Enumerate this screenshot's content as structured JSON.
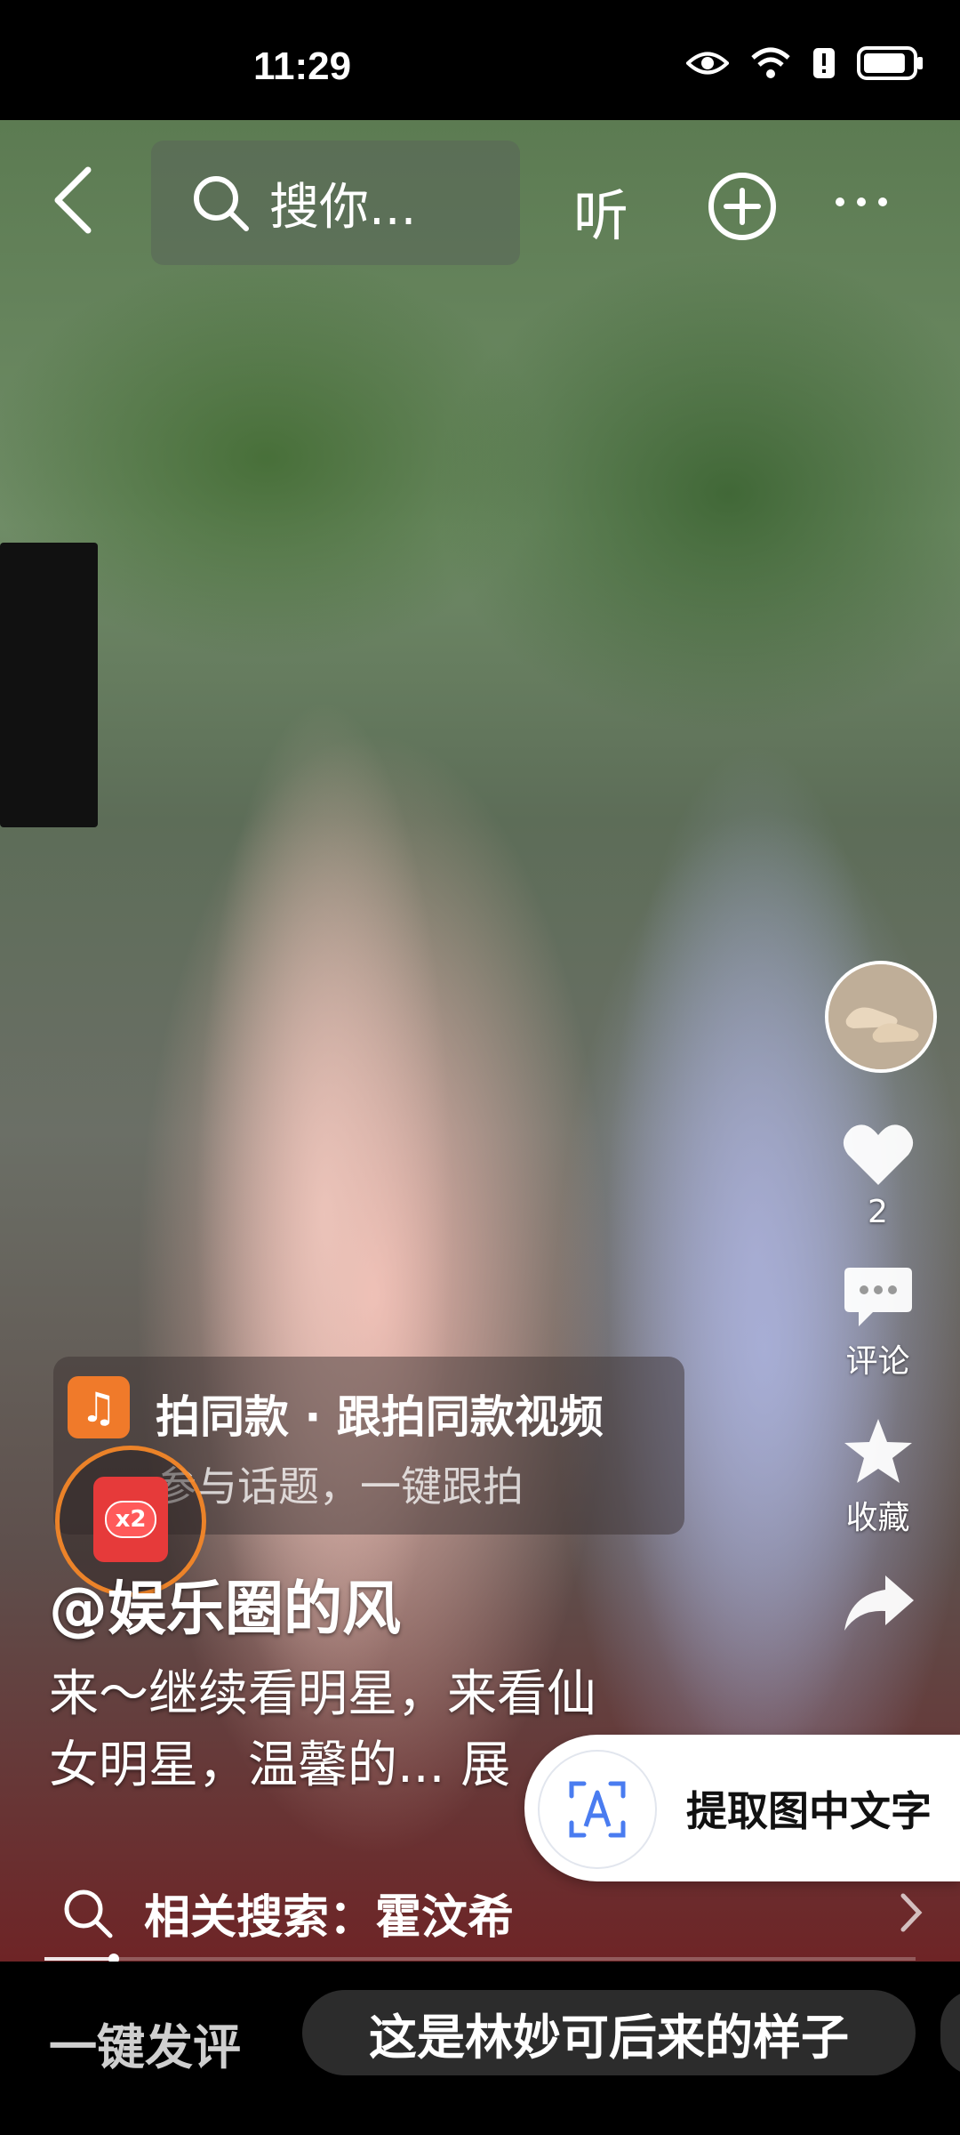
{
  "status_bar": {
    "time": "11:29",
    "icons": [
      "eye-icon",
      "wifi-icon",
      "alert-icon",
      "battery-icon"
    ],
    "battery_level": 0.85
  },
  "top_bar": {
    "search_placeholder": "搜你...",
    "listen_label": "听"
  },
  "right_actions": {
    "like_count": "2",
    "comment_label": "评论",
    "favorite_label": "收藏"
  },
  "shoot_panel": {
    "title": "拍同款 · 跟拍同款视频",
    "subtitle": "参与话题，一键跟拍"
  },
  "redpacket": {
    "badge": "x2"
  },
  "post": {
    "author": "@娱乐圈的风",
    "description_line1": "来～继续看明星，来看仙",
    "description_line2": "女明星，温馨的... 展"
  },
  "ocr": {
    "label": "提取图中文字"
  },
  "related_search": {
    "text": "相关搜索：霍汶希"
  },
  "playback": {
    "progress": 0.08
  },
  "bottom_bar": {
    "quick_comment": "一键发评",
    "suggestion": "这是林妙可后来的样子"
  },
  "colors": {
    "accent_orange": "#f07a2a",
    "redpacket_red": "#e63a3a",
    "ocr_blue": "#4a7cf0"
  }
}
